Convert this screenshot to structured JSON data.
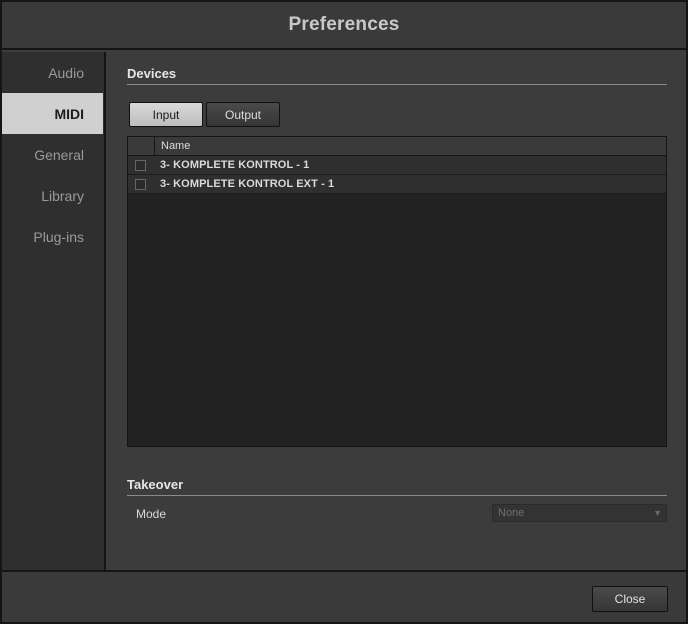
{
  "window": {
    "title": "Preferences"
  },
  "sidebar": {
    "items": [
      {
        "label": "Audio",
        "active": false
      },
      {
        "label": "MIDI",
        "active": true
      },
      {
        "label": "General",
        "active": false
      },
      {
        "label": "Library",
        "active": false
      },
      {
        "label": "Plug-ins",
        "active": false
      }
    ]
  },
  "devices": {
    "section_title": "Devices",
    "tabs": {
      "input": "Input",
      "output": "Output",
      "selected": "Input"
    },
    "table": {
      "columns": [
        "",
        "Name"
      ],
      "rows": [
        {
          "checked": false,
          "name": "3- KOMPLETE KONTROL - 1"
        },
        {
          "checked": false,
          "name": "3- KOMPLETE KONTROL EXT - 1"
        }
      ]
    }
  },
  "takeover": {
    "section_title": "Takeover",
    "mode_label": "Mode",
    "mode_value": "None"
  },
  "footer": {
    "close_label": "Close"
  }
}
